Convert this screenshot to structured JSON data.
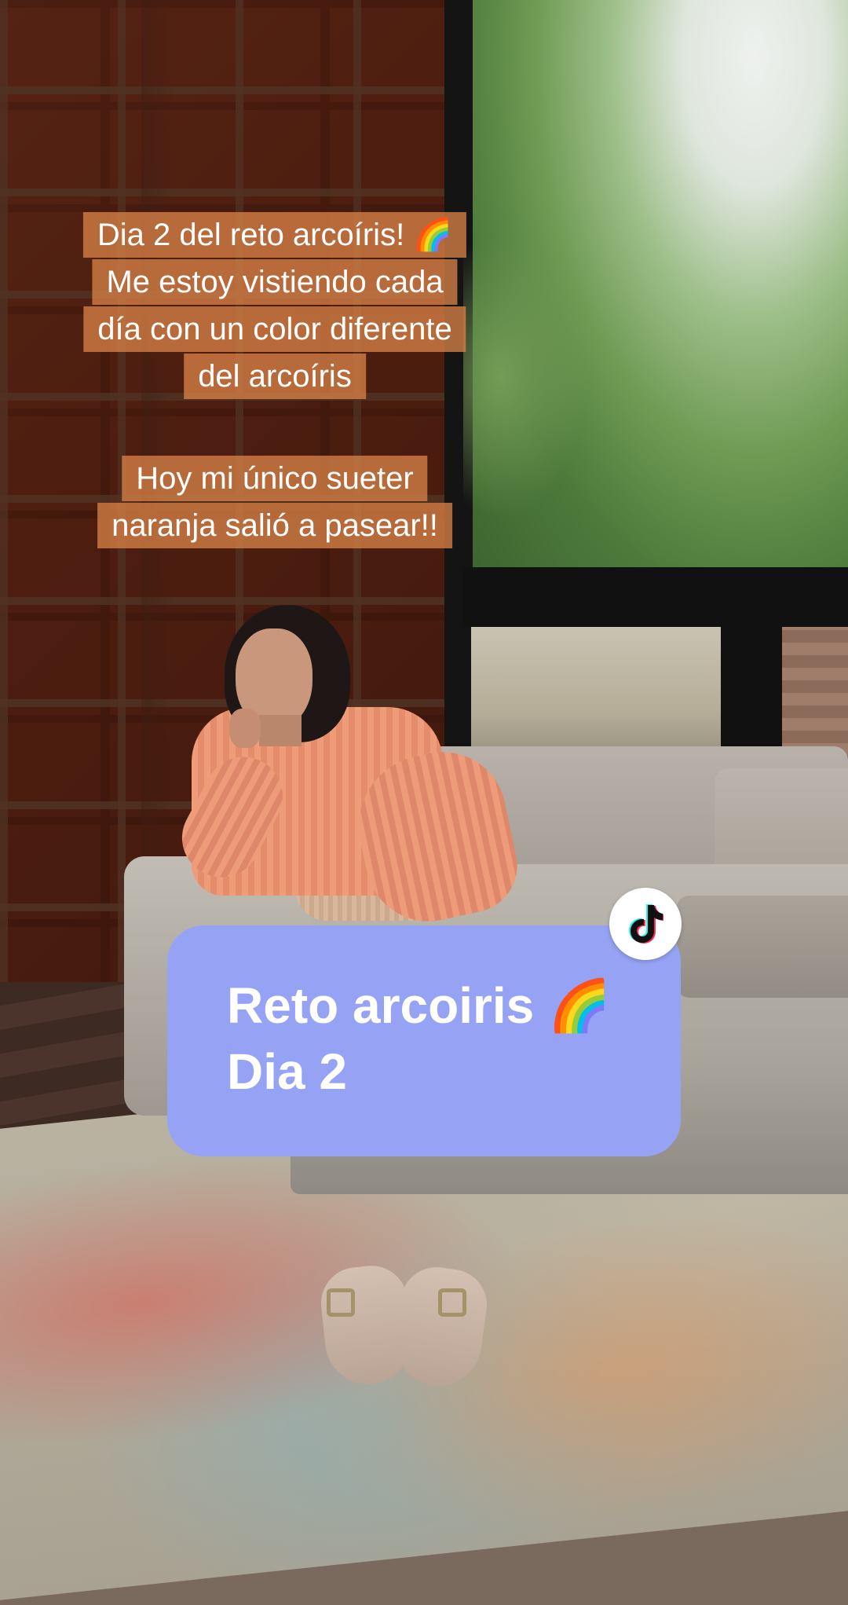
{
  "caption_top": {
    "lines": [
      "Dia 2 del reto arcoíris! 🌈",
      "Me estoy vistiendo cada",
      "día con un color diferente",
      "del arcoíris"
    ]
  },
  "caption_middle": {
    "lines": [
      "Hoy mi único sueter",
      "naranja salió a pasear!!"
    ]
  },
  "sticker": {
    "line1": "Reto arcoiris 🌈",
    "line2": "Dia 2",
    "background": "#96a3f4"
  },
  "badge": {
    "icon": "tiktok-logo-icon"
  }
}
